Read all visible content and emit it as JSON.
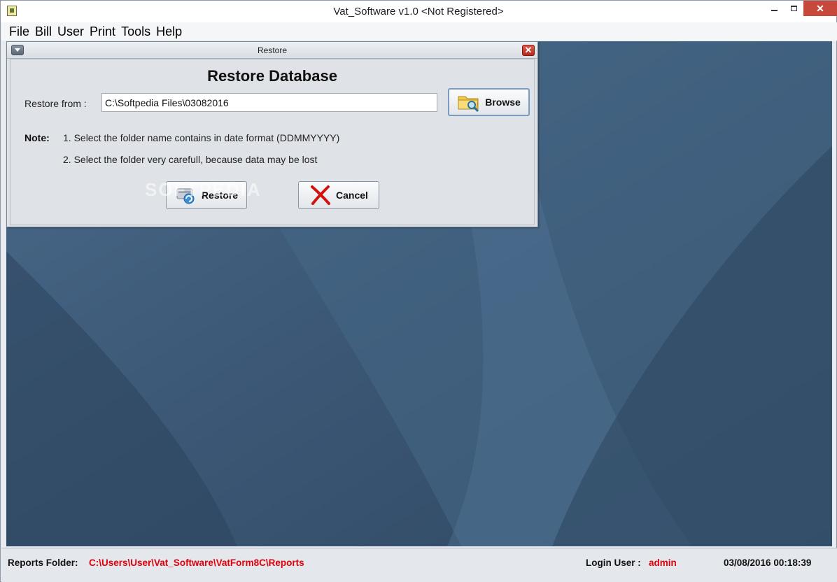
{
  "window": {
    "title": "Vat_Software v1.0 <Not Registered>",
    "close_glyph": "✕"
  },
  "menu": {
    "items": [
      "File",
      "Bill",
      "User",
      "Print",
      "Tools",
      "Help"
    ]
  },
  "dialog": {
    "title": "Restore",
    "close_glyph": "✕",
    "heading": "Restore Database",
    "restore_from_label": "Restore from :",
    "restore_from_value": "C:\\Softpedia Files\\03082016",
    "browse_label": "Browse",
    "note_label": "Note:",
    "note_lines": [
      "1. Select the folder name contains in date format (DDMMYYYY)",
      "2. Select the folder very carefull, because data may be lost"
    ],
    "restore_button": "Restore",
    "cancel_button": "Cancel",
    "watermark": "SOFTPEDIA"
  },
  "statusbar": {
    "reports_folder_label": "Reports Folder:",
    "reports_folder_path": "C:\\Users\\User\\Vat_Software\\VatForm8C\\Reports",
    "login_user_label": "Login User :",
    "login_user": "admin",
    "datetime": "03/08/2016  00:18:39"
  },
  "colors": {
    "desktop": "#3d5a78",
    "status_red": "#e0000b",
    "close_red": "#c7493b"
  }
}
